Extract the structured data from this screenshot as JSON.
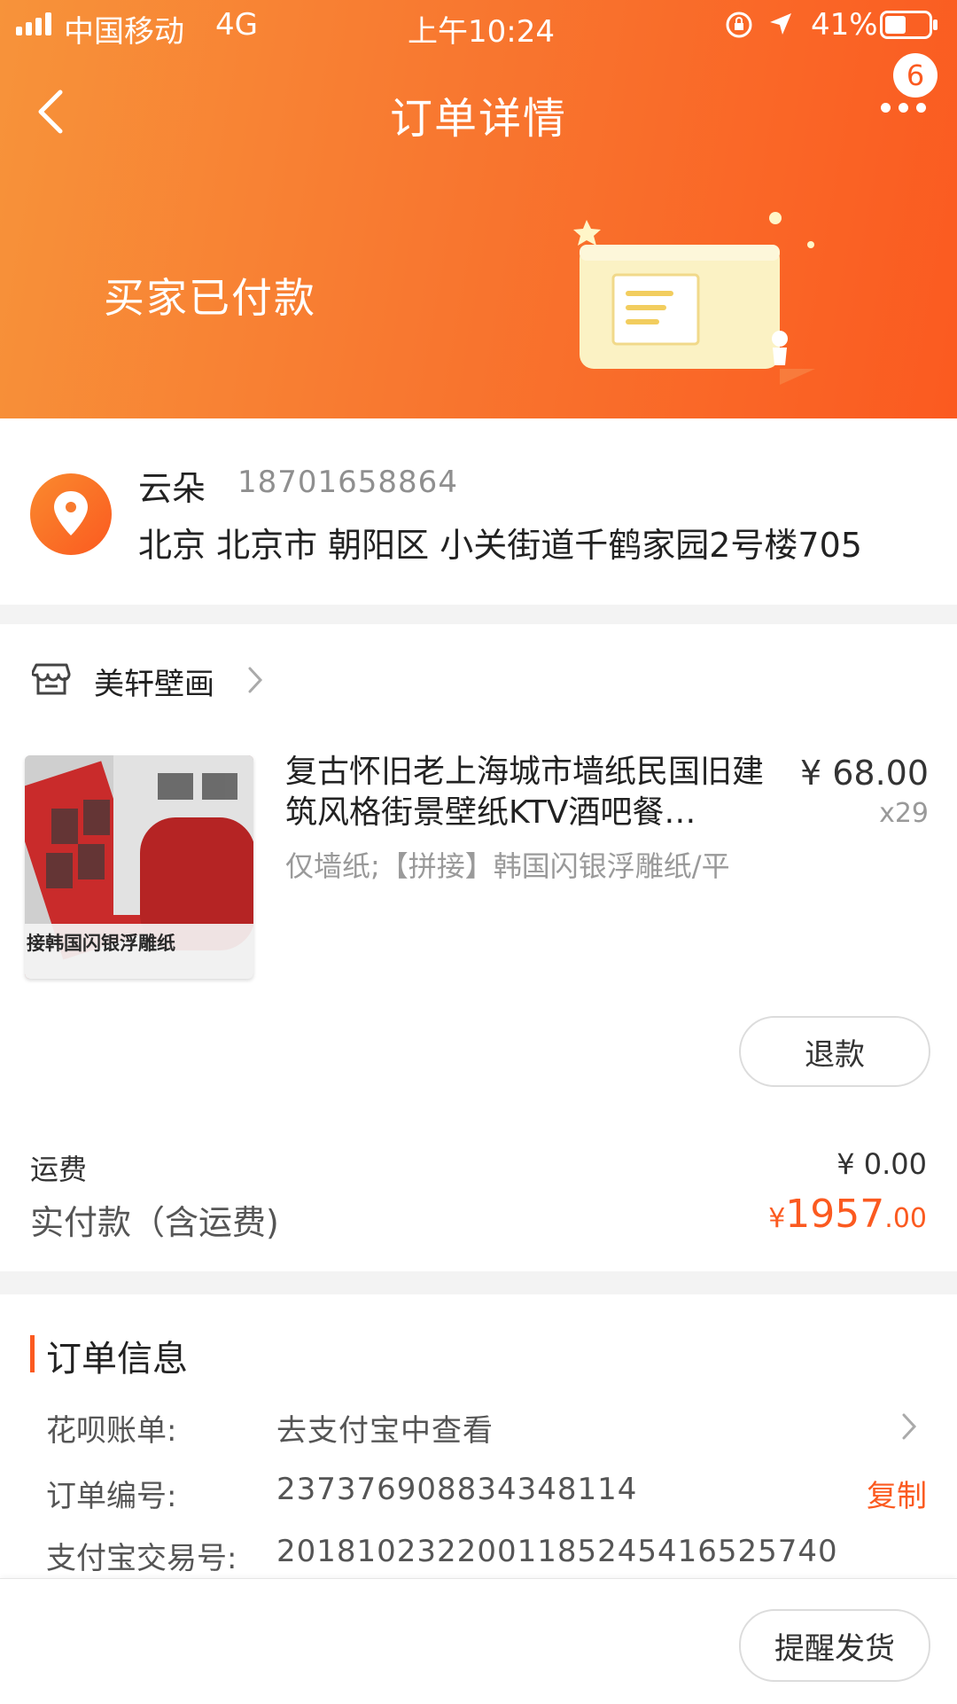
{
  "status_bar": {
    "carrier": "中国移动",
    "network": "4G",
    "time": "上午10:24",
    "battery": "41%"
  },
  "nav": {
    "title": "订单详情",
    "more_badge": "6"
  },
  "order_status": "买家已付款",
  "address": {
    "name": "云朵",
    "phone": "18701658864",
    "line": "北京 北京市 朝阳区 小关街道千鹤家园2号楼705"
  },
  "shop": {
    "name": "美轩壁画"
  },
  "product": {
    "title": "复古怀旧老上海城市墙纸民国旧建筑风格街景壁纸KTV酒吧餐…",
    "sku": "仅墙纸;【拼接】韩国闪银浮雕纸/平",
    "price": "¥ 68.00",
    "qty": "x29",
    "thumb_text": "接韩国闪银浮雕纸",
    "refund_label": "退款"
  },
  "fees": {
    "shipping_label": "运费",
    "shipping_value": "¥ 0.00",
    "total_label": "实付款（含运费)",
    "total_currency": "¥",
    "total_int": "1957",
    "total_dec": ".00"
  },
  "order_info": {
    "title": "订单信息",
    "rows": [
      {
        "label": "花呗账单:",
        "value": "去支付宝中查看"
      },
      {
        "label": "订单编号:",
        "value": "237376908834348114",
        "action": "复制"
      },
      {
        "label": "支付宝交易号:",
        "value": "2018102322001185245416525740"
      }
    ]
  },
  "footer": {
    "remind_label": "提醒发货"
  },
  "colors": {
    "accent": "#fb5a20",
    "header_start": "#f7933a"
  }
}
